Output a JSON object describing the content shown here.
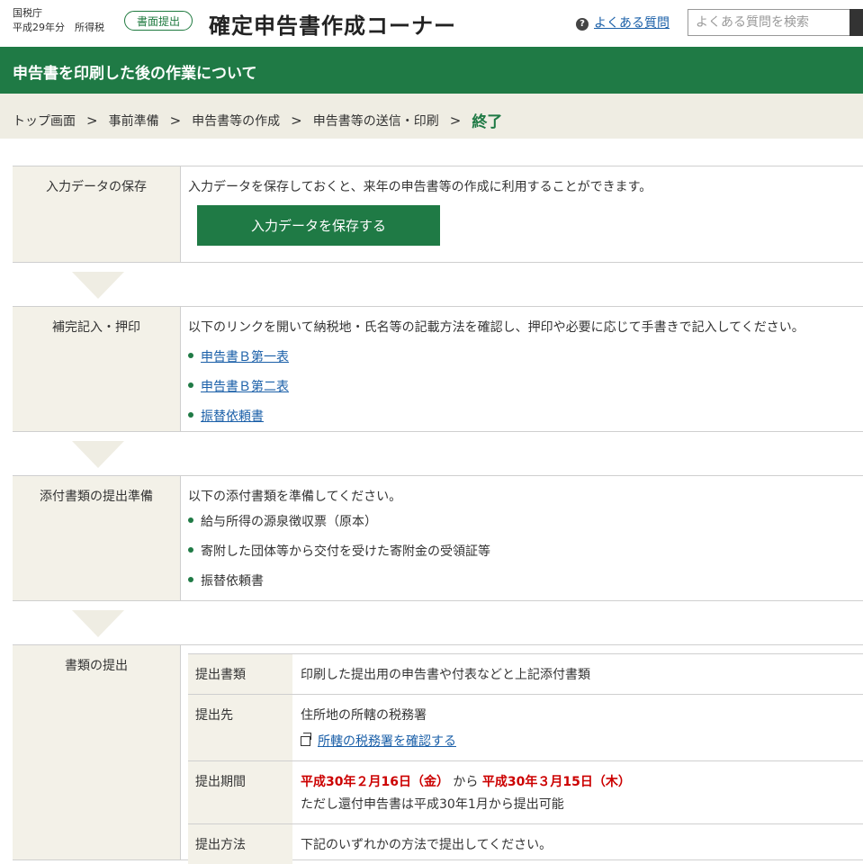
{
  "header": {
    "agency": "国税庁",
    "year_tax": "平成29年分　所得税",
    "badge": "書面提出",
    "title": "確定申告書作成コーナー",
    "faq_link": "よくある質問",
    "search_placeholder": "よくある質問を検索"
  },
  "page_title": "申告書を印刷した後の作業について",
  "breadcrumb": {
    "items": [
      "トップ画面",
      "事前準備",
      "申告書等の作成",
      "申告書等の送信・印刷"
    ],
    "current": "終了",
    "separator": ">"
  },
  "sections": {
    "save": {
      "label": "入力データの保存",
      "text": "入力データを保存しておくと、来年の申告書等の作成に利用することができます。",
      "button": "入力データを保存する"
    },
    "supplement": {
      "label": "補完記入・押印",
      "text": "以下のリンクを開いて納税地・氏名等の記載方法を確認し、押印や必要に応じて手書きで記入してください。",
      "links": [
        "申告書Ｂ第一表",
        "申告書Ｂ第二表",
        "振替依頼書"
      ]
    },
    "attachments": {
      "label": "添付書類の提出準備",
      "text": "以下の添付書類を準備してください。",
      "items": [
        "給与所得の源泉徴収票（原本）",
        "寄附した団体等から交付を受けた寄附金の受領証等",
        "振替依頼書"
      ]
    },
    "submission": {
      "label": "書類の提出",
      "rows": {
        "docs_key": "提出書類",
        "docs_val": "印刷した提出用の申告書や付表などと上記添付書類",
        "dest_key": "提出先",
        "dest_val": "住所地の所轄の税務署",
        "dest_link": "所轄の税務署を確認する",
        "period_key": "提出期間",
        "period_start": "平成30年２月16日（金）",
        "period_mid": "から",
        "period_end": "平成30年３月15日（木）",
        "period_note": "ただし還付申告書は平成30年1月から提出可能",
        "method_key": "提出方法",
        "method_val": "下記のいずれかの方法で提出してください。"
      }
    }
  },
  "colors": {
    "brand_green": "#1f7a45",
    "beige": "#efede3",
    "link": "#1a5fa8",
    "alert_red": "#cc0000"
  }
}
